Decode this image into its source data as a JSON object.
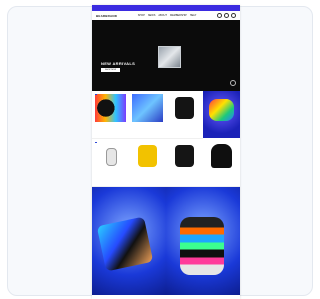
{
  "promo_bar": {
    "text": ""
  },
  "header": {
    "logo": "BEARBRAND",
    "links": [
      "SHOP",
      "NEWS",
      "ABOUT",
      "MEMBERSHIP",
      "HELP"
    ],
    "icons": [
      "search-icon",
      "user-icon",
      "cart-icon"
    ]
  },
  "hero": {
    "title": "NEW ARRIVALS",
    "cta": "SHOP NOW"
  },
  "products": [
    {
      "title": "",
      "price": "",
      "badge": "",
      "thumb": "vinyl-colorful"
    },
    {
      "title": "",
      "price": "",
      "badge": "",
      "thumb": "box-blue"
    },
    {
      "title": "",
      "price": "",
      "badge": "",
      "thumb": "tshirt-black"
    },
    {
      "promo": true,
      "text": ""
    },
    {
      "title": "",
      "price": "",
      "badge": "",
      "thumb": "figure-box"
    },
    {
      "title": "",
      "price": "",
      "badge": "",
      "thumb": "tshirt-yellow"
    },
    {
      "title": "",
      "price": "",
      "badge": "",
      "thumb": "tshirt-black-2"
    },
    {
      "title": "",
      "price": "",
      "badge": "",
      "thumb": "hoodie-black"
    }
  ],
  "feature_tiles": [
    {
      "title": "",
      "subtitle": ""
    },
    {
      "title": "",
      "subtitle": ""
    }
  ],
  "colors": {
    "promo": "#3b2be0",
    "accent": "#2f4ad8",
    "hero_bg": "#0b0b0b"
  }
}
